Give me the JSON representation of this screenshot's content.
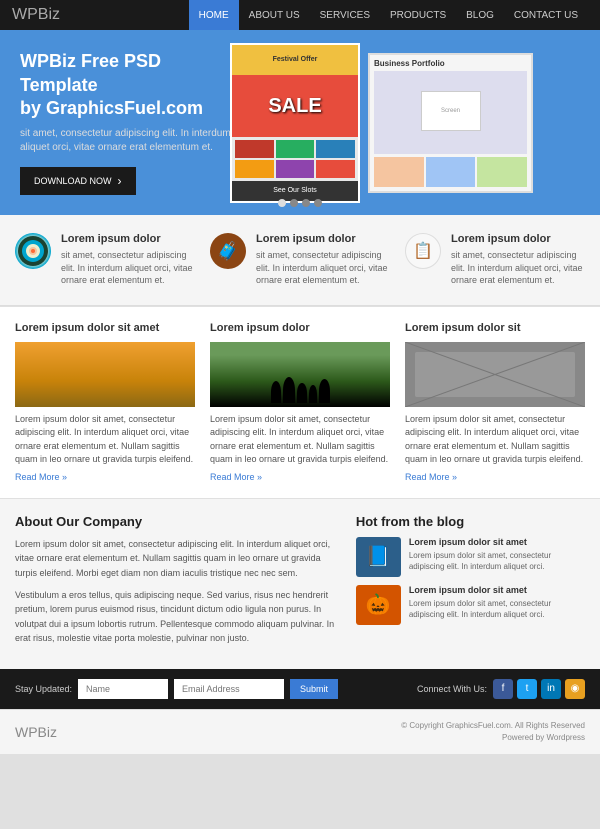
{
  "header": {
    "logo_main": "WPBiz",
    "nav": [
      {
        "label": "HOME",
        "active": true
      },
      {
        "label": "ABOUT US",
        "active": false
      },
      {
        "label": "SERVICES",
        "active": false
      },
      {
        "label": "PRODUCTS",
        "active": false
      },
      {
        "label": "BLOG",
        "active": false
      },
      {
        "label": "CONTACT US",
        "active": false
      }
    ]
  },
  "hero": {
    "title": "WPBiz Free PSD Template\nby GraphicsFuel.com",
    "subtitle": "sit amet, consectetur adipiscing elit. In interdum aliquet orci, vitae ornare erat elementum et.",
    "button_label": "DOWNLOAD NOW",
    "right_panel_title": "Business Portfolio",
    "dots": 4
  },
  "features": [
    {
      "title": "Lorem ipsum dolor",
      "text": "sit amet, consectetur adipiscing elit. In interdum aliquet orci, vitae ornare erat elementum et."
    },
    {
      "title": "Lorem ipsum dolor",
      "text": "sit amet, consectetur adipiscing elit. In interdum aliquet orci, vitae ornare erat elementum et."
    },
    {
      "title": "Lorem ipsum dolor",
      "text": "sit amet, consectetur adipiscing elit. In interdum aliquet orci, vitae ornare erat elementum et."
    }
  ],
  "blog": {
    "posts": [
      {
        "title": "Lorem ipsum dolor sit amet",
        "text": "Lorem ipsum dolor sit amet, consectetur adipiscing elit. In interdum aliquet orci, vitae ornare erat elementum et. Nullam sagittis quam in leo ornare ut gravida turpis eleifend.",
        "read_more": "Read More »"
      },
      {
        "title": "Lorem ipsum dolor",
        "text": "Lorem ipsum dolor sit amet, consectetur adipiscing elit. In interdum aliquet orci, vitae ornare erat elementum et. Nullam sagittis quam in leo ornare ut gravida turpis eleifend.",
        "read_more": "Read More »"
      },
      {
        "title": "Lorem ipsum dolor sit",
        "text": "Lorem ipsum dolor sit amet, consectetur adipiscing elit. In interdum aliquet orci, vitae ornare erat elementum et. Nullam sagittis quam in leo ornare ut gravida turpis eleifend.",
        "read_more": "Read More »"
      }
    ]
  },
  "about": {
    "heading": "About Our Company",
    "para1": "Lorem ipsum dolor sit amet, consectetur adipiscing elit. In interdum aliquet orci, vitae ornare erat elementum et. Nullam sagittis quam in leo ornare ut gravida turpis eleifend. Morbi eget diam non diam iaculis tristique nec nec sem.",
    "para2": "Vestibulum a eros tellus, quis adipiscing neque. Sed varius, risus nec hendrerit pretium, lorem purus euismod risus, tincidunt dictum odio ligula non purus. In volutpat dui a ipsum lobortis rutrum. Pellentesque commodo aliquam pulvinar. In erat risus, molestie vitae porta molestie, pulvinar non justo."
  },
  "hot_blog": {
    "heading": "Hot from the blog",
    "items": [
      {
        "title": "Lorem ipsum dolor sit amet",
        "text": "Lorem ipsum dolor sit amet, consectetur adipiscing elit. In interdum aliquet orci.",
        "icon": "📘"
      },
      {
        "title": "Lorem ipsum dolor sit amet",
        "text": "Lorem ipsum dolor sit amet, consectetur adipiscing elit. In interdum aliquet orci.",
        "icon": "🎃"
      }
    ]
  },
  "footer_bar": {
    "stay_label": "Stay Updated:",
    "name_placeholder": "Name",
    "email_placeholder": "Email Address",
    "submit_label": "Submit",
    "connect_label": "Connect With Us:"
  },
  "footer": {
    "logo": "WPBiz",
    "copyright": "© Copyright GraphicsFuel.com. All Rights Reserved",
    "powered": "Powered by Wordpress"
  }
}
